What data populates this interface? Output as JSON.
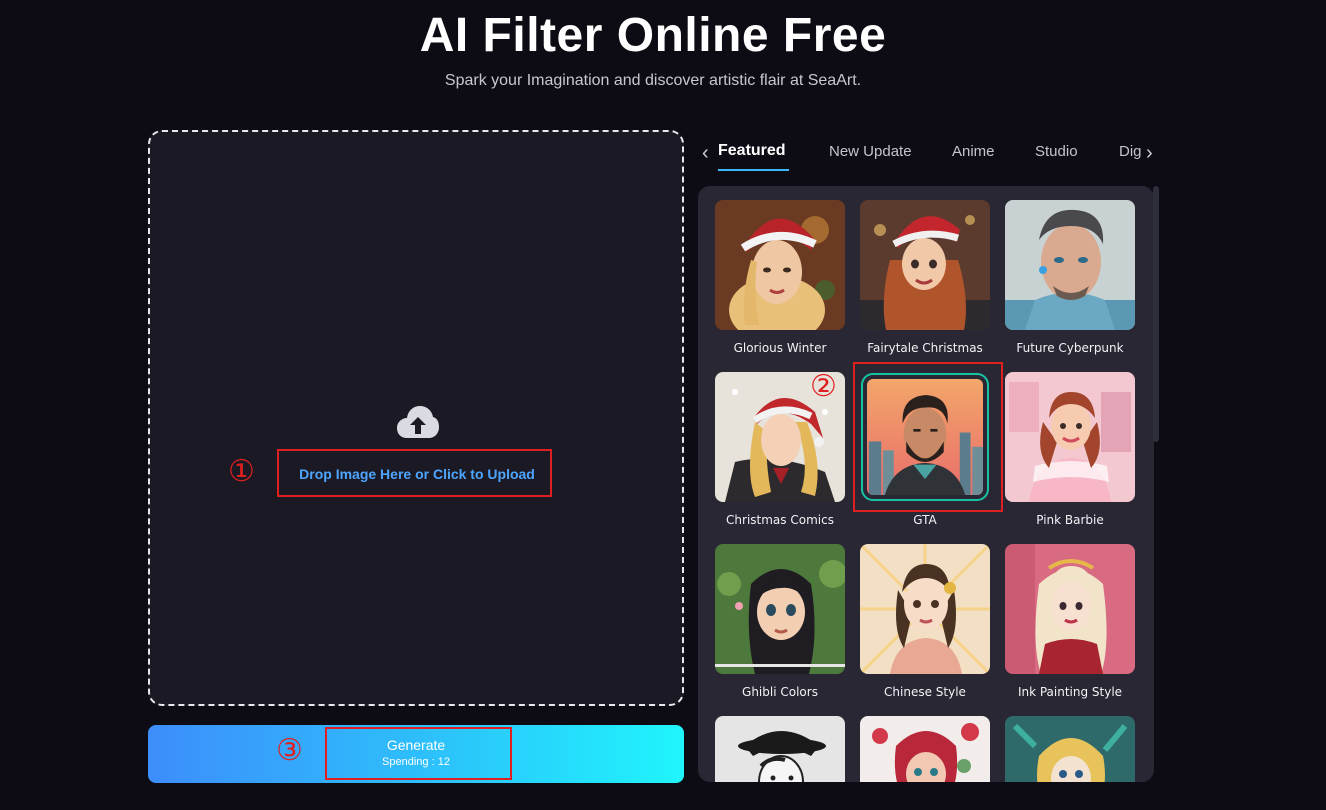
{
  "header": {
    "title": "AI Filter Online Free",
    "subtitle": "Spark your Imagination and discover artistic flair at SeaArt."
  },
  "upload": {
    "label": "Drop Image Here or Click to Upload",
    "icon": "cloud-upload-icon"
  },
  "generate": {
    "label": "Generate",
    "cost": "Spending : 12"
  },
  "annotations": {
    "step1": "①",
    "step2": "②",
    "step3": "③",
    "color": "#e02020"
  },
  "tabs": [
    {
      "label": "Featured",
      "active": true
    },
    {
      "label": "New Update",
      "active": false
    },
    {
      "label": "Anime",
      "active": false
    },
    {
      "label": "Studio",
      "active": false
    },
    {
      "label": "Dig",
      "active": false
    }
  ],
  "filters": [
    {
      "name": "Glorious Winter"
    },
    {
      "name": "Fairytale Christmas"
    },
    {
      "name": "Future Cyberpunk"
    },
    {
      "name": "Christmas Comics"
    },
    {
      "name": "GTA",
      "selected": true
    },
    {
      "name": "Pink Barbie"
    },
    {
      "name": "Ghibli Colors"
    },
    {
      "name": "Chinese Style"
    },
    {
      "name": "Ink Painting Style"
    },
    {
      "name": ""
    },
    {
      "name": ""
    },
    {
      "name": ""
    }
  ],
  "colors": {
    "background": "#0d0c15",
    "panel": "#282733",
    "upload_bg": "#1b1a24",
    "link_blue": "#4ea5ff",
    "accent_teal": "#18c3a5",
    "gradient_start": "#3d8dfb",
    "gradient_end": "#1ff5fc"
  }
}
